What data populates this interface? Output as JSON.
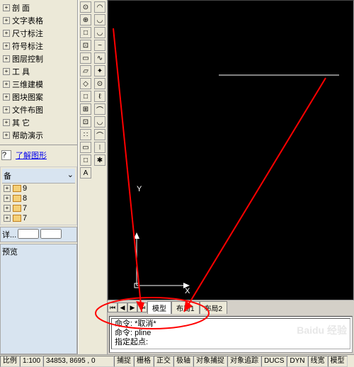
{
  "menu": {
    "items": [
      "剖  面",
      "文字表格",
      "尺寸标注",
      "符号标注",
      "图层控制",
      "工  具",
      "三维建模",
      "图块图案",
      "文件布图",
      "其  它",
      "帮助演示"
    ]
  },
  "link": {
    "text": "了解图形",
    "icon": "?"
  },
  "folder": {
    "header": "备",
    "items": [
      "9",
      "8",
      "7",
      "7"
    ]
  },
  "detail": {
    "label": "详...",
    "v1": "",
    "v2": ""
  },
  "preview": {
    "label": "预览"
  },
  "toolbar1": [
    "⊙",
    "⊕",
    "□",
    "⊡",
    "▭",
    "▱",
    "◇",
    "□",
    "⊞",
    "⊡",
    "∷",
    "▭",
    "□",
    "A"
  ],
  "toolbar2": [
    "◠",
    "◡",
    "◡",
    "~",
    "∿",
    "✦",
    "⊙",
    "ℓ",
    "⌒",
    "◡",
    "⌒",
    "⁝",
    "✱"
  ],
  "drawing": {
    "y_label": "Y",
    "x_label": "X"
  },
  "tabs": {
    "items": [
      "模型",
      "布局1",
      "布局2"
    ],
    "active": 0
  },
  "cmd": {
    "line1": "命令: *取消*",
    "line2": "命令: pline",
    "line3": "指定起点:"
  },
  "status": {
    "scale_label": "比例",
    "scale_value": "1:100",
    "coords": "34853, 8695 , 0",
    "buttons": [
      "捕捉",
      "栅格",
      "正交",
      "极轴",
      "对象捕捉",
      "对象追踪",
      "DUCS",
      "DYN",
      "线宽",
      "模型"
    ]
  },
  "watermark": "Baidu 经验"
}
